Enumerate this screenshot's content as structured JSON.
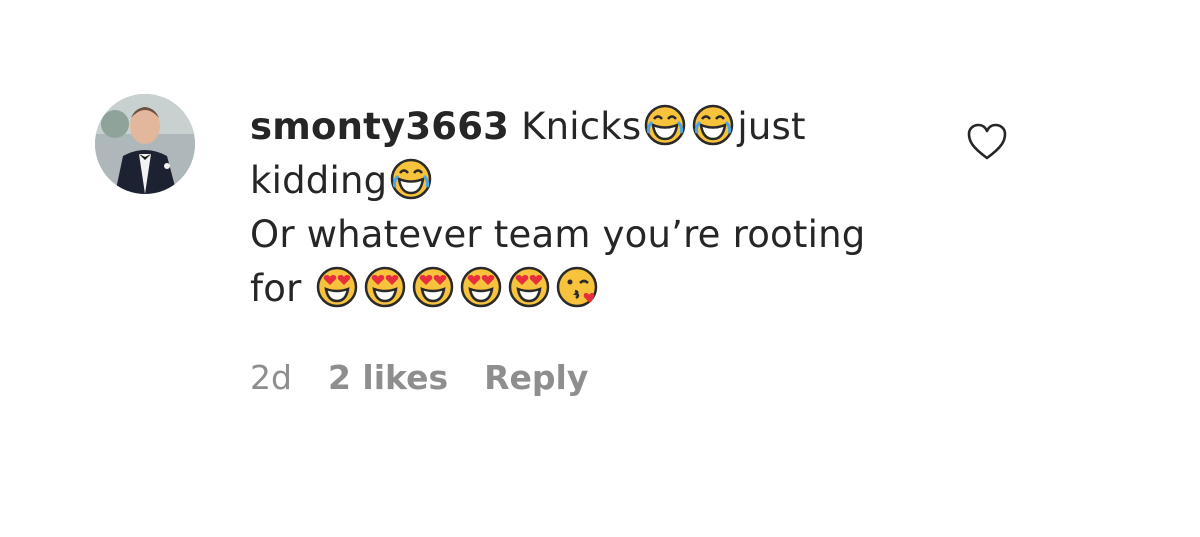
{
  "comment": {
    "username": "smonty3663",
    "line1_text": "Knicks",
    "line1_tail": "just",
    "line2_text": "kidding",
    "line3_text": "Or whatever team you’re rooting",
    "line4_text": "for",
    "emojis": {
      "laugh": "face-with-tears-of-joy-icon",
      "heart_eyes": "smiling-face-with-heart-eyes-icon",
      "kiss": "face-blowing-a-kiss-icon"
    },
    "timestamp": "2d",
    "likes": "2 likes",
    "reply_label": "Reply"
  },
  "colors": {
    "text": "#262626",
    "meta": "#8e8e8e",
    "emoji_yellow": "#f7c23c",
    "emoji_outline": "#2a2a2a",
    "heart_red": "#e62e3d"
  }
}
